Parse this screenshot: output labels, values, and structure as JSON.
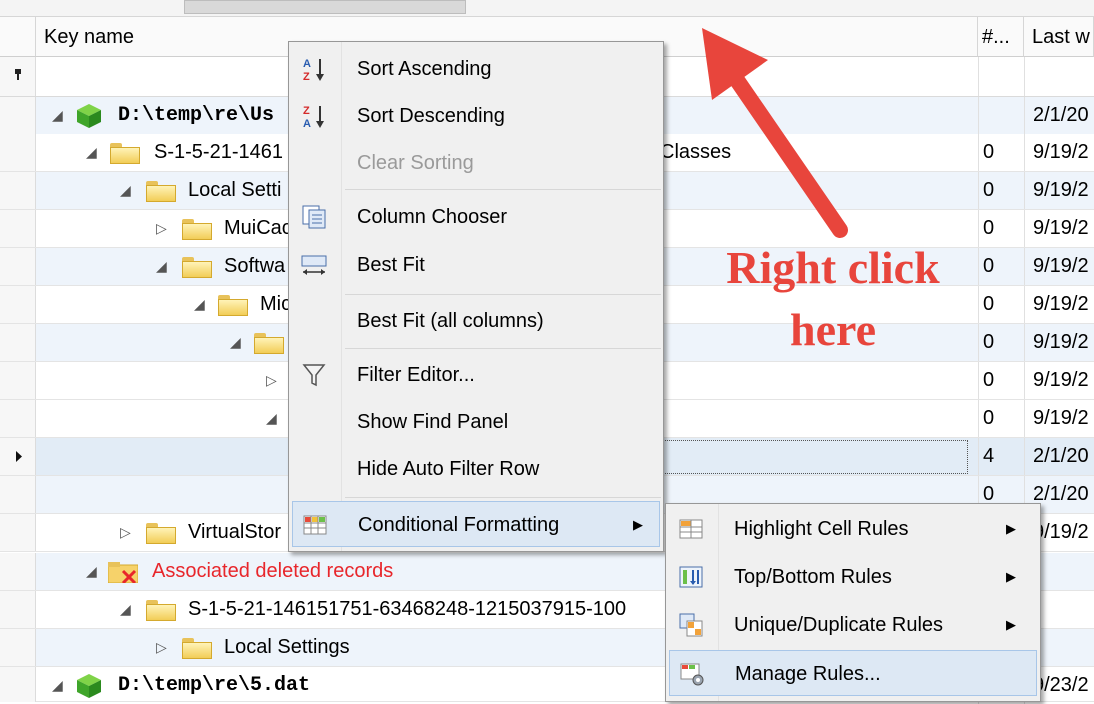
{
  "columns": {
    "key_name": "Key name",
    "count": "#...",
    "last_write": "Last w"
  },
  "filter_row_icon": "filter-pin-icon",
  "rows": [
    {
      "key": "D:\\temp\\re\\Us",
      "num": "",
      "date": "2/1/20"
    },
    {
      "key": "S-1-5-21-1461",
      "key_tail": "Classes",
      "num": "0",
      "date": "9/19/2"
    },
    {
      "key": "Local Setti",
      "num": "0",
      "date": "9/19/2"
    },
    {
      "key": "MuiCac",
      "num": "0",
      "date": "9/19/2"
    },
    {
      "key": "Softwa",
      "num": "0",
      "date": "9/19/2"
    },
    {
      "key": "Mic",
      "num": "0",
      "date": "9/19/2"
    },
    {
      "key": "",
      "num": "0",
      "date": "9/19/2"
    },
    {
      "key": "",
      "num": "0",
      "date": "9/19/2"
    },
    {
      "key": "",
      "num": "0",
      "date": "9/19/2"
    },
    {
      "key": "",
      "num": "4",
      "date": "2/1/20"
    },
    {
      "key": "",
      "num": "0",
      "date": "2/1/20"
    },
    {
      "key": "VirtualStor",
      "num": "",
      "date": "9/19/2"
    },
    {
      "key": "Associated deleted records",
      "num": "",
      "date": ""
    },
    {
      "key": "S-1-5-21-146151751-63468248-1215037915-100",
      "num": "",
      "date": ""
    },
    {
      "key": "Local Settings",
      "num": "",
      "date": ""
    },
    {
      "key": "D:\\temp\\re\\5.dat",
      "num": "",
      "date": "9/23/2"
    }
  ],
  "context_menu": {
    "sort_ascending": "Sort Ascending",
    "sort_descending": "Sort Descending",
    "clear_sorting": "Clear Sorting",
    "column_chooser": "Column Chooser",
    "best_fit": "Best Fit",
    "best_fit_all": "Best Fit (all columns)",
    "filter_editor": "Filter Editor...",
    "show_find_panel": "Show Find Panel",
    "hide_auto_filter_row": "Hide Auto Filter Row",
    "conditional_formatting": "Conditional Formatting"
  },
  "submenu": {
    "highlight_cell_rules": "Highlight Cell Rules",
    "top_bottom_rules": "Top/Bottom Rules",
    "unique_duplicate_rules": "Unique/Duplicate Rules",
    "manage_rules": "Manage Rules..."
  },
  "annotation": {
    "line1": "Right click",
    "line2": "here",
    "color": "#e8453c"
  }
}
